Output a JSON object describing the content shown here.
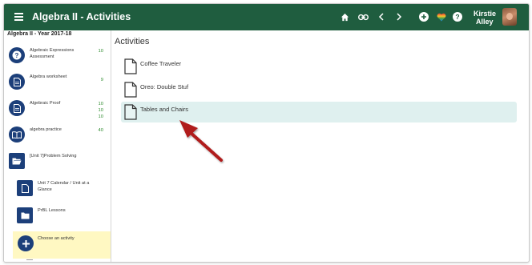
{
  "topbar": {
    "title": "Algebra II - Activities",
    "user_name_line1": "Kirstie",
    "user_name_line2": "Alley",
    "bg_color": "#1f5d3f",
    "icons": [
      "home-icon",
      "link-icon",
      "chevron-left-icon",
      "chevron-right-icon",
      "add-circle-icon",
      "heart-icon",
      "help-icon"
    ]
  },
  "sidebar": {
    "header": "Algebra II - Year 2017-18",
    "items": [
      {
        "label": "Algebraic Expressions Assessment",
        "counts": [
          "10"
        ],
        "icon": "question-icon"
      },
      {
        "label": "Algebra worksheet",
        "counts": [
          "9"
        ],
        "icon": "document-icon"
      },
      {
        "label": "Algebraic Proof",
        "counts": [
          "10",
          "10",
          "10"
        ],
        "icon": "document-icon"
      },
      {
        "label": "algebra practice",
        "counts": [
          "40"
        ],
        "icon": "book-icon"
      },
      {
        "label": "[Unit 7]Problem Solving",
        "counts": [],
        "icon": "folder-open-icon"
      },
      {
        "label": "Unit 7 Calendar / Unit at a Glance",
        "counts": [],
        "icon": "document-icon"
      },
      {
        "label": "PrBL Lessons",
        "counts": [],
        "icon": "folder-icon"
      },
      {
        "label": "Choose an activity",
        "counts": [],
        "icon": "plus-icon"
      }
    ]
  },
  "main": {
    "title": "Activities",
    "activities": [
      {
        "label": "Coffee Traveler"
      },
      {
        "label": "Oreo: Double Stuf"
      },
      {
        "label": "Tables and Chairs"
      }
    ]
  },
  "colors": {
    "accent_navy": "#1c3f7a",
    "count_green": "#2c8a2c",
    "highlight_yellow": "#fff8c2",
    "active_row": "#dff0ef",
    "annotation_arrow": "#b01e1e"
  }
}
